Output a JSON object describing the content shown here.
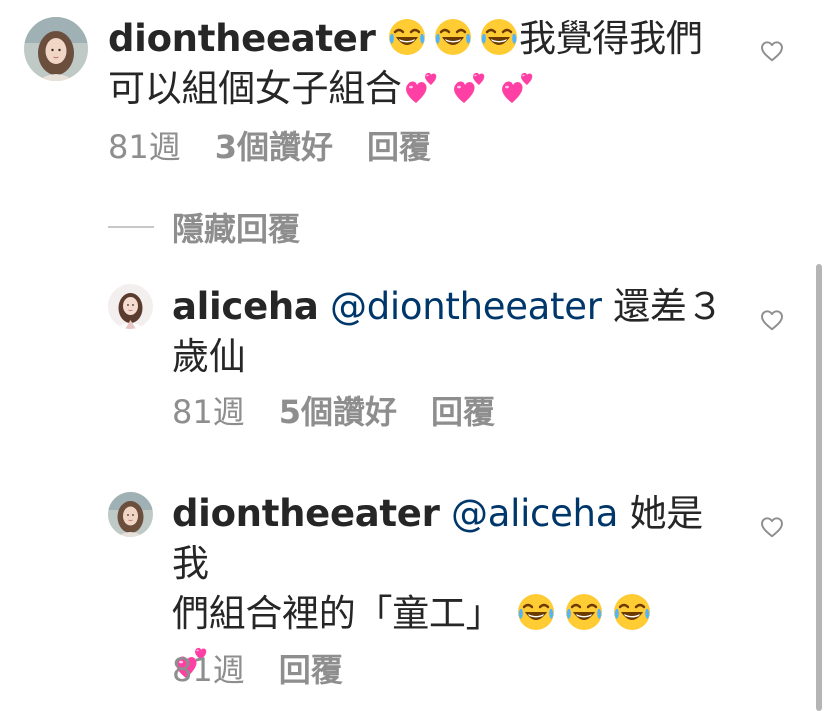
{
  "comments": [
    {
      "username": "diontheeater",
      "mention": "",
      "text_segments": [
        "我覺得我們",
        "可以組個女子組合"
      ],
      "emojis_after_username": [
        "face-with-tears-of-joy",
        "face-with-tears-of-joy",
        "face-with-tears-of-joy"
      ],
      "emojis_end": [
        "two-hearts",
        "two-hearts",
        "two-hearts"
      ],
      "time": "81週",
      "likes": "3個讚好",
      "reply_label": "回覆"
    },
    {
      "username": "aliceha",
      "mention": "@diontheeater",
      "text_segments": [
        "還差３",
        "歲仙"
      ],
      "time": "81週",
      "likes": "5個讚好",
      "reply_label": "回覆"
    },
    {
      "username": "diontheeater",
      "mention": "@aliceha",
      "text_segments": [
        "她是我",
        "們組合裡的「童工」"
      ],
      "emojis_end": [
        "face-with-tears-of-joy",
        "face-with-tears-of-joy",
        "face-with-tears-of-joy",
        "two-hearts"
      ],
      "time": "81週",
      "likes": "",
      "reply_label": "回覆"
    }
  ],
  "hide_replies_label": "隱藏回覆",
  "icons": {
    "like": "heart-outline-icon",
    "laugh": "face-with-tears-of-joy",
    "hearts": "two-hearts"
  },
  "colors": {
    "text": "#262626",
    "meta": "#8e8e8e",
    "mention": "#00376b",
    "heart_outline": "#8e8e8e",
    "hearts_emoji": "#ff3fa4"
  }
}
